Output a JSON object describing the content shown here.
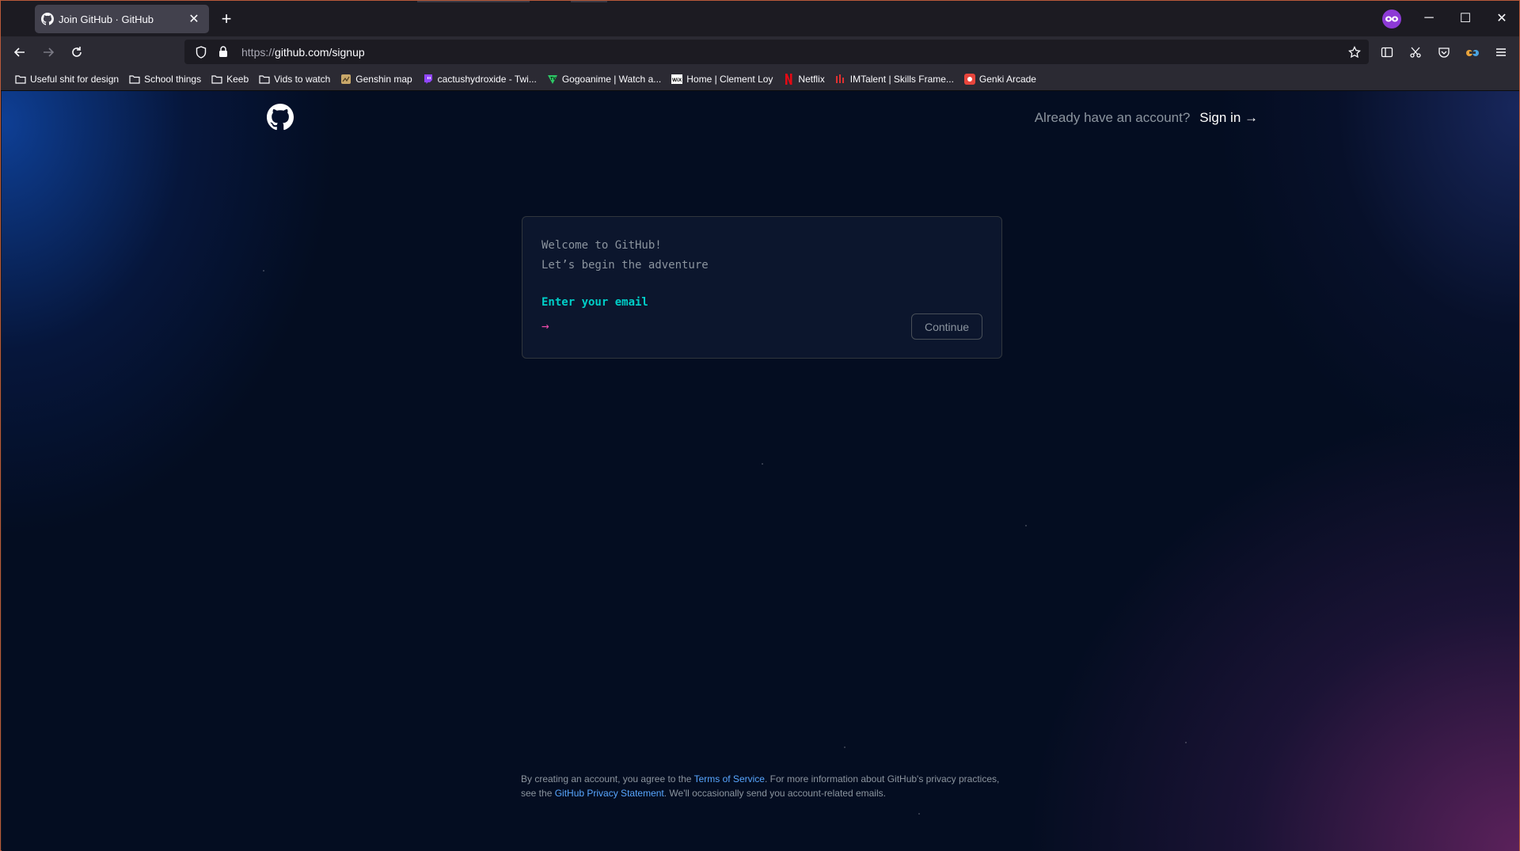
{
  "browser": {
    "tab": {
      "title": "Join GitHub · GitHub",
      "close": "✕"
    },
    "new_tab": "+",
    "window_controls": {
      "minimize": "─",
      "maximize": "☐",
      "close": "✕"
    },
    "url": {
      "protocol": "https://",
      "host_path": "github.com/signup"
    },
    "bookmarks": [
      {
        "label": "Useful shit for design",
        "icon": "folder-icon"
      },
      {
        "label": "School things",
        "icon": "folder-icon"
      },
      {
        "label": "Keeb",
        "icon": "folder-icon"
      },
      {
        "label": "Vids to watch",
        "icon": "folder-icon"
      },
      {
        "label": "Genshin map",
        "icon": "map-icon"
      },
      {
        "label": "cactushydroxide - Twi...",
        "icon": "twitch-icon"
      },
      {
        "label": "Gogoanime | Watch a...",
        "icon": "gogoanime-icon"
      },
      {
        "label": "Home | Clement Loy",
        "icon": "wix-icon"
      },
      {
        "label": "Netflix",
        "icon": "netflix-icon"
      },
      {
        "label": "IMTalent | Skills Frame...",
        "icon": "imtalent-icon"
      },
      {
        "label": "Genki Arcade",
        "icon": "genki-icon"
      }
    ]
  },
  "page": {
    "header": {
      "already_text": "Already have an account?",
      "signin_label": "Sign in →"
    },
    "card": {
      "welcome_line1": "Welcome to GitHub!",
      "welcome_line2": "Let’s begin the adventure",
      "prompt": "Enter your email",
      "arrow": "→",
      "email_value": "",
      "continue_label": "Continue"
    },
    "footer": {
      "part1": "By creating an account, you agree to the ",
      "terms_link": "Terms of Service",
      "part2": ". For more information about GitHub's privacy practices, see the ",
      "privacy_link": "GitHub Privacy Statement",
      "part3": ". We'll occasionally send you account-related emails."
    }
  },
  "colors": {
    "accent_cyan": "#00cfc8",
    "accent_pink": "#ea4aaa",
    "link_blue": "#58a6ff",
    "page_background": "#040d21"
  }
}
